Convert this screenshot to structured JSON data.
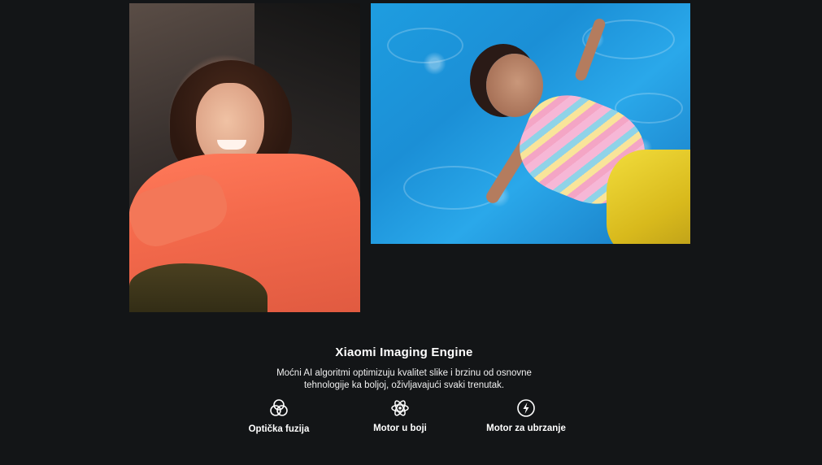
{
  "gallery": {
    "images": [
      {
        "alt": "Xiaomi portrait selfie"
      },
      {
        "alt": "Xiaomi pool photo"
      }
    ]
  },
  "engine": {
    "title": "Xiaomi Imaging Engine",
    "description_line1": "Moćni AI algoritmi optimizuju kvalitet slike i brzinu od osnovne",
    "description_line2": "tehnologije ka boljoj, oživljavajući svaki trenutak."
  },
  "features": [
    {
      "label": "Optička fuzija",
      "icon": "optical-fusion-icon"
    },
    {
      "label": "Motor u boji",
      "icon": "color-engine-icon"
    },
    {
      "label": "Motor za ubrzanje",
      "icon": "acceleration-engine-icon"
    }
  ],
  "colors": {
    "background": "#131517",
    "text": "#ffffff"
  }
}
